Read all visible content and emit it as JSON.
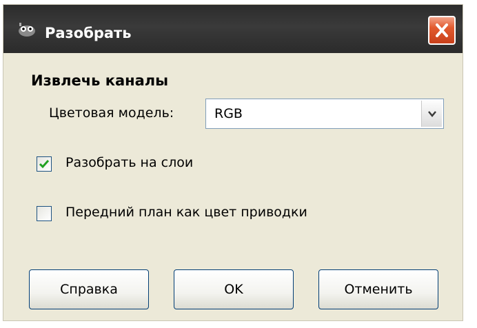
{
  "window": {
    "title": "Разобрать"
  },
  "section": {
    "title": "Извлечь каналы"
  },
  "color_model": {
    "label": "Цветовая модель:",
    "value": "RGB"
  },
  "options": [
    {
      "label": "Разобрать на слои",
      "checked": true
    },
    {
      "label": "Передний план как цвет приводки",
      "checked": false
    }
  ],
  "buttons": {
    "help": "Справка",
    "ok": "OK",
    "cancel": "Отменить"
  },
  "colors": {
    "title_bar": "#2c2c2c",
    "dialog_bg": "#ece9d8",
    "close_button": "#e25b2f",
    "accent_border": "#003c74"
  },
  "icons": {
    "app": "gimp-icon",
    "close": "close-icon",
    "dropdown": "chevron-down-icon",
    "check": "check-icon"
  }
}
